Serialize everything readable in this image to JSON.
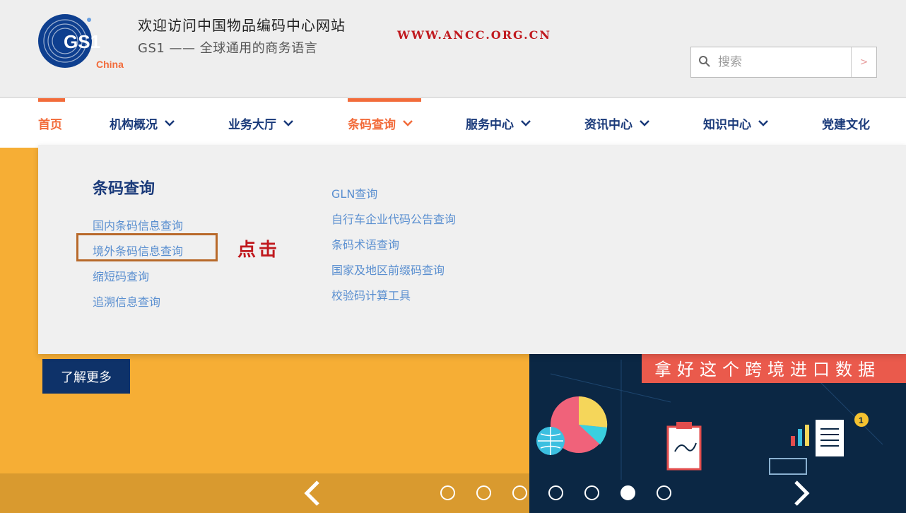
{
  "header": {
    "welcome": "欢迎访问中国物品编码中心网站",
    "tagline": "GS1 —— 全球通用的商务语言",
    "url": "WWW.ANCC.ORG.CN",
    "logo_text": "GS1",
    "logo_sub": "China",
    "search": {
      "placeholder": "搜索",
      "button": ">"
    }
  },
  "nav": {
    "items": [
      {
        "label": "首页",
        "active": true
      },
      {
        "label": "机构概况"
      },
      {
        "label": "业务大厅"
      },
      {
        "label": "条码查询",
        "active": true
      },
      {
        "label": "服务中心"
      },
      {
        "label": "资讯中心"
      },
      {
        "label": "知识中心"
      },
      {
        "label": "党建文化"
      }
    ]
  },
  "dropdown": {
    "title": "条码查询",
    "col1": [
      "国内条码信息查询",
      "境外条码信息查询",
      "缩短码查询",
      "追溯信息查询"
    ],
    "col2": [
      "GLN查询",
      "自行车企业代码公告查询",
      "条码术语查询",
      "国家及地区前缀码查询",
      "校验码计算工具"
    ],
    "annotation": "点击"
  },
  "banner": {
    "cta": "了解更多",
    "slogan": "拿好这个跨境进口数据"
  },
  "colors": {
    "brand": "#1a3a7a",
    "accent": "#f26b3a",
    "banner": "#f6ae35",
    "link": "#5a8fd0"
  }
}
